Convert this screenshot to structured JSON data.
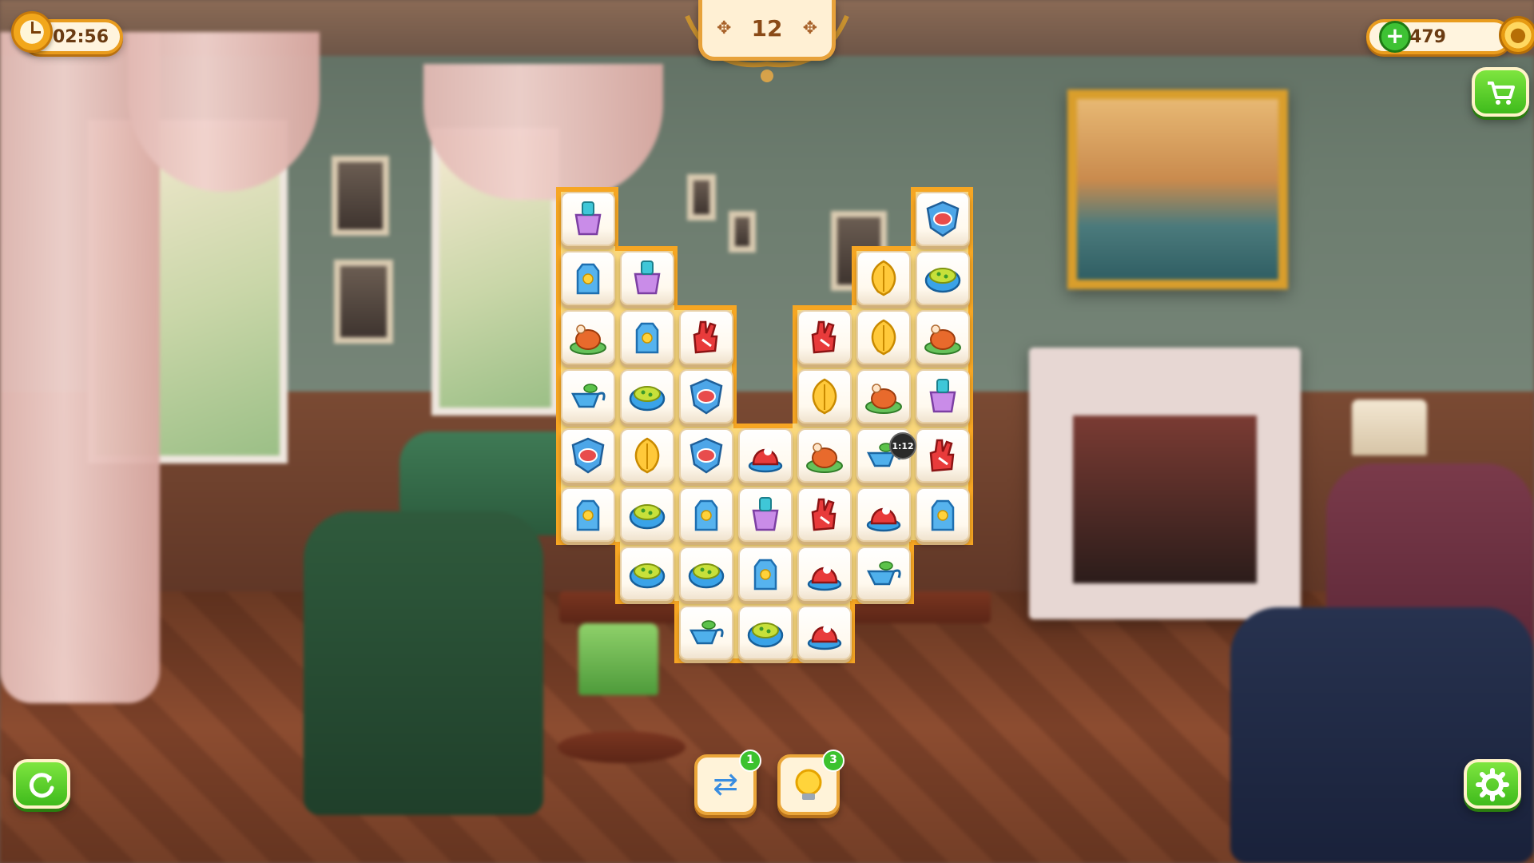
{
  "hud": {
    "timer": "02:56",
    "level": "12",
    "coins": "479"
  },
  "boosters": {
    "shuffle_count": "1",
    "hint_count": "3"
  },
  "bomb_timer": "1:12",
  "icons": {
    "timer": "clock-icon",
    "add_coins": "plus-icon",
    "coin": "coin-icon",
    "shop": "shopping-cart-icon",
    "restart": "restart-icon",
    "settings": "gear-icon",
    "shuffle": "shuffle-icon",
    "hint": "lightbulb-icon"
  },
  "colors": {
    "tile_bg": "#fffaf0",
    "board_outline": "#f6a623",
    "button_green": "#3fbb1c"
  },
  "board": {
    "columns": 7,
    "rows": 8,
    "tiles": [
      {
        "row": 0,
        "col": 0,
        "type": "bucket"
      },
      {
        "row": 0,
        "col": 6,
        "type": "shield"
      },
      {
        "row": 1,
        "col": 0,
        "type": "milk"
      },
      {
        "row": 1,
        "col": 1,
        "type": "bucket"
      },
      {
        "row": 1,
        "col": 5,
        "type": "leaf"
      },
      {
        "row": 1,
        "col": 6,
        "type": "bowl"
      },
      {
        "row": 2,
        "col": 0,
        "type": "turkey"
      },
      {
        "row": 2,
        "col": 1,
        "type": "milk"
      },
      {
        "row": 2,
        "col": 2,
        "type": "foam-hand"
      },
      {
        "row": 2,
        "col": 4,
        "type": "foam-hand"
      },
      {
        "row": 2,
        "col": 5,
        "type": "leaf"
      },
      {
        "row": 2,
        "col": 6,
        "type": "turkey"
      },
      {
        "row": 3,
        "col": 0,
        "type": "gravy"
      },
      {
        "row": 3,
        "col": 1,
        "type": "bowl"
      },
      {
        "row": 3,
        "col": 2,
        "type": "shield"
      },
      {
        "row": 3,
        "col": 4,
        "type": "leaf"
      },
      {
        "row": 3,
        "col": 5,
        "type": "turkey"
      },
      {
        "row": 3,
        "col": 6,
        "type": "bucket"
      },
      {
        "row": 4,
        "col": 0,
        "type": "shield"
      },
      {
        "row": 4,
        "col": 1,
        "type": "leaf"
      },
      {
        "row": 4,
        "col": 2,
        "type": "shield"
      },
      {
        "row": 4,
        "col": 3,
        "type": "hat"
      },
      {
        "row": 4,
        "col": 4,
        "type": "turkey"
      },
      {
        "row": 4,
        "col": 5,
        "type": "gravy"
      },
      {
        "row": 4,
        "col": 6,
        "type": "foam-hand"
      },
      {
        "row": 5,
        "col": 0,
        "type": "milk"
      },
      {
        "row": 5,
        "col": 1,
        "type": "bowl"
      },
      {
        "row": 5,
        "col": 2,
        "type": "milk"
      },
      {
        "row": 5,
        "col": 3,
        "type": "bucket"
      },
      {
        "row": 5,
        "col": 4,
        "type": "foam-hand"
      },
      {
        "row": 5,
        "col": 5,
        "type": "hat"
      },
      {
        "row": 5,
        "col": 6,
        "type": "milk"
      },
      {
        "row": 6,
        "col": 1,
        "type": "bowl"
      },
      {
        "row": 6,
        "col": 2,
        "type": "bowl"
      },
      {
        "row": 6,
        "col": 3,
        "type": "milk"
      },
      {
        "row": 6,
        "col": 4,
        "type": "hat"
      },
      {
        "row": 6,
        "col": 5,
        "type": "gravy"
      },
      {
        "row": 7,
        "col": 2,
        "type": "gravy"
      },
      {
        "row": 7,
        "col": 3,
        "type": "bowl"
      },
      {
        "row": 7,
        "col": 4,
        "type": "hat"
      }
    ]
  }
}
